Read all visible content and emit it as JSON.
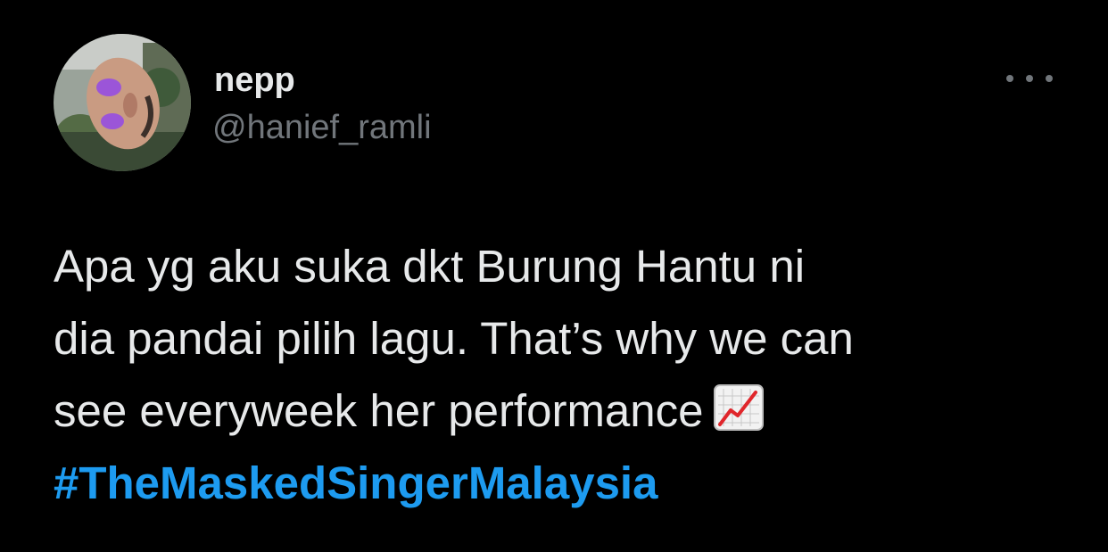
{
  "author": {
    "display_name": "nepp",
    "handle": "@hanief_ramli"
  },
  "icons": {
    "more": "more-options-icon",
    "emoji": "chart-increasing-emoji"
  },
  "tweet": {
    "lines": [
      "Apa yg aku suka dkt Burung Hantu ni",
      "dia pandai pilih lagu. That’s why we can",
      "see everyweek her performance"
    ],
    "hashtag": "#TheMaskedSingerMalaysia"
  },
  "colors": {
    "background": "#000000",
    "text": "#e7e9ea",
    "secondary": "#71767b",
    "link": "#1d9bf0"
  }
}
